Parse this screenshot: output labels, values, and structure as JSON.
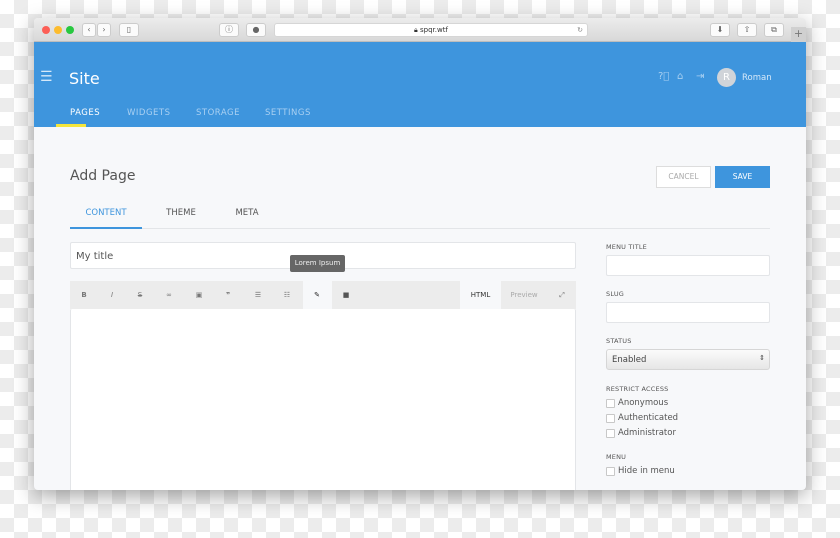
{
  "browser": {
    "url": "spqr.wtf"
  },
  "app": {
    "title": "Site",
    "user_initial": "R",
    "user_name": "Roman",
    "nav": [
      {
        "label": "PAGES"
      },
      {
        "label": "WIDGETS"
      },
      {
        "label": "STORAGE"
      },
      {
        "label": "SETTINGS"
      }
    ]
  },
  "page": {
    "title": "Add Page",
    "cancel": "CANCEL",
    "save": "SAVE",
    "tabs": [
      {
        "label": "CONTENT"
      },
      {
        "label": "THEME"
      },
      {
        "label": "META"
      }
    ],
    "title_value": "My title",
    "tooltip": "Lorem Ipsum",
    "toolbar": {
      "html": "HTML",
      "preview": "Preview"
    }
  },
  "sidebar": {
    "menu_title_label": "MENU TITLE",
    "slug_label": "SLUG",
    "status_label": "STATUS",
    "status_value": "Enabled",
    "restrict_label": "RESTRICT ACCESS",
    "access": [
      {
        "label": "Anonymous"
      },
      {
        "label": "Authenticated"
      },
      {
        "label": "Administrator"
      }
    ],
    "menu_label": "MENU",
    "hide_label": "Hide in menu"
  },
  "colors": {
    "accent": "#3e95dd",
    "active_tab_underline": "#f5e63c"
  }
}
